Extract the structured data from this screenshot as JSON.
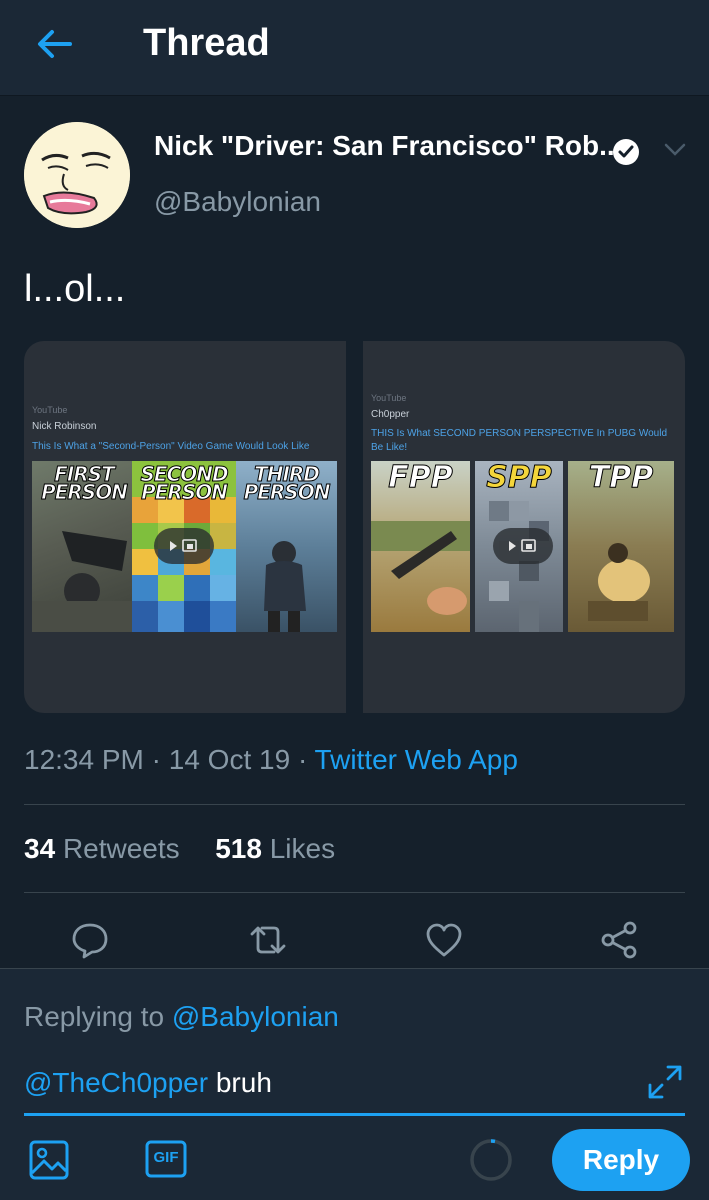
{
  "header": {
    "title": "Thread"
  },
  "tweet": {
    "author_name": "Nick \"Driver: San Francisco\" Rob...",
    "handle": "@Babylonian",
    "text": "l...ol...",
    "time": "12:34 PM",
    "date": "14 Oct 19",
    "source": "Twitter Web App",
    "retweet_count": "34",
    "retweet_label": "Retweets",
    "like_count": "518",
    "like_label": "Likes"
  },
  "media": [
    {
      "site": "YouTube",
      "channel": "Nick Robinson",
      "video_title": "This Is What a \"Second-Person\" Video Game Would Look Like",
      "thumb_labels": [
        "FIRST",
        "PERSON",
        "SECOND",
        "PERSON",
        "THIRD",
        "PERSON"
      ]
    },
    {
      "site": "YouTube",
      "channel": "Ch0pper",
      "video_title": "THIS Is What SECOND PERSON PERSPECTIVE In PUBG Would Be Like!",
      "thumb_labels": [
        "FPP",
        "SPP",
        "TPP"
      ]
    }
  ],
  "reply": {
    "replying_prefix": "Replying to",
    "replying_to": "@Babylonian",
    "draft_mention": "@TheCh0pper",
    "draft_text": " bruh",
    "button_label": "Reply",
    "gif_label": "GIF"
  },
  "icons": {
    "back": "arrow-left-icon",
    "verified": "verified-badge-icon",
    "more": "chevron-down-icon",
    "reply": "comment-icon",
    "retweet": "retweet-icon",
    "like": "heart-icon",
    "share": "share-icon",
    "expand": "expand-icon",
    "media": "image-icon",
    "gif": "gif-icon",
    "counter": "character-counter-icon"
  },
  "colors": {
    "accent": "#1da1f2",
    "background": "#15202b",
    "secondary_text": "#8899a6"
  }
}
